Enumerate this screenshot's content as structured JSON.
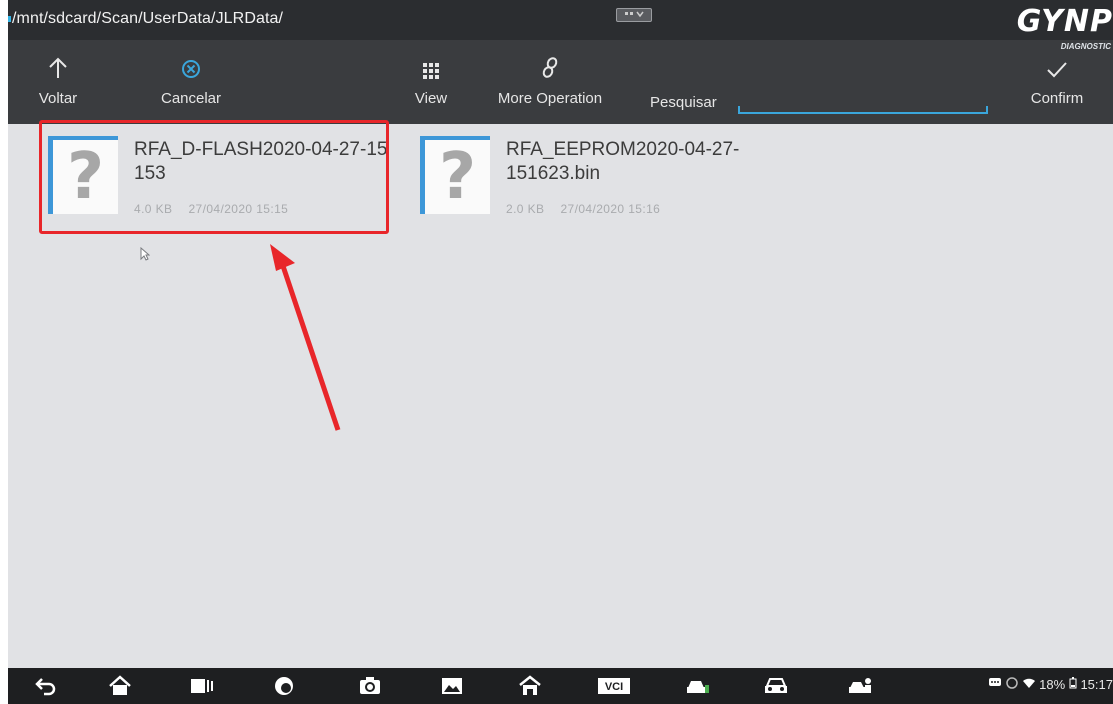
{
  "path": "/mnt/sdcard/Scan/UserData/JLRData/",
  "brand": {
    "name": "GYNP",
    "subtitle": "DIAGNOSTIC"
  },
  "toolbar": {
    "back_label": "Voltar",
    "cancel_label": "Cancelar",
    "view_label": "View",
    "more_label": "More Operation",
    "search_label": "Pesquisar",
    "search_value": "",
    "confirm_label": "Confirm"
  },
  "files": [
    {
      "name": "RFA_D-FLASH2020-04-27-15153",
      "size": "4.0 KB",
      "date": "27/04/2020 15:15",
      "icon": "unknown-file-icon"
    },
    {
      "name": "RFA_EEPROM2020-04-27-151623.bin",
      "size": "2.0 KB",
      "date": "27/04/2020 15:16",
      "icon": "unknown-file-icon"
    }
  ],
  "status": {
    "battery": "18%",
    "time": "15:17"
  },
  "colors": {
    "accent": "#3aa6dc",
    "highlight": "#e8262a",
    "toolbar": "#3a3c3f",
    "background": "#e1e2e5"
  }
}
